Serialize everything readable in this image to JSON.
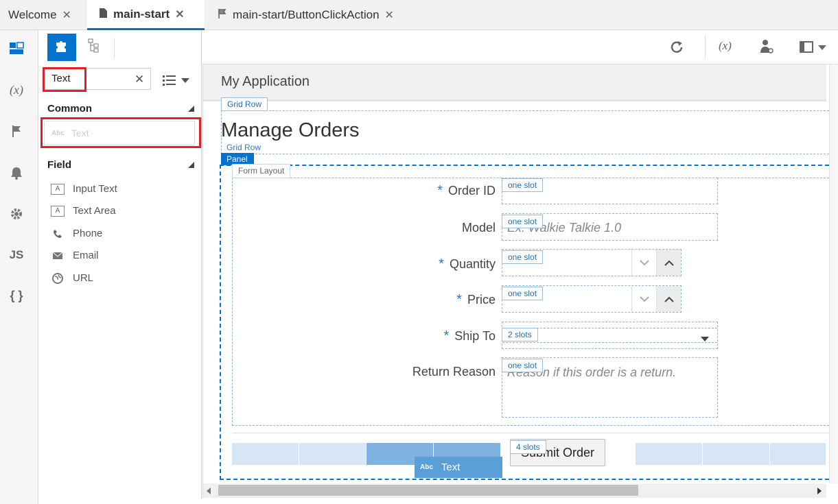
{
  "tabs": [
    {
      "label": "Welcome",
      "close": "✕"
    },
    {
      "label": "main-start",
      "close": "✕"
    },
    {
      "label": "main-start/ButtonClickAction",
      "close": "✕"
    }
  ],
  "rail": {
    "icons": [
      "page-designer-icon",
      "variables-icon",
      "flag-icon",
      "bell-icon",
      "gear-icon",
      "js-icon",
      "json-icon"
    ],
    "var_text": "(x)",
    "js_text": "JS",
    "json_text": "{ }"
  },
  "palette": {
    "search_value": "Text",
    "clear": "✕",
    "sections": {
      "common": {
        "title": "Common",
        "items": [
          "Text"
        ]
      },
      "field": {
        "title": "Field",
        "items": [
          "Input Text",
          "Text Area",
          "Phone",
          "Email",
          "URL"
        ]
      }
    }
  },
  "toolbar": {
    "icons": [
      "reload-icon",
      "variables-icon",
      "user-role-icon",
      "preview-device-icon"
    ],
    "var_text": "(x)"
  },
  "canvas": {
    "app_title": "My Application",
    "page_heading": "Manage Orders",
    "labels": {
      "grid_row": "Grid Row",
      "panel": "Panel",
      "form_layout": "Form Layout",
      "one_slot": "one slot",
      "two_slots": "2 slots",
      "four_slots": "4 slots"
    },
    "fields": [
      {
        "label": "Order ID",
        "required": true,
        "placeholder": ""
      },
      {
        "label": "Model",
        "required": false,
        "placeholder": "Ex: Walkie Talkie 1.0"
      },
      {
        "label": "Quantity",
        "required": true,
        "placeholder": ""
      },
      {
        "label": "Price",
        "required": true,
        "placeholder": ""
      },
      {
        "label": "Ship To",
        "required": true,
        "placeholder": ""
      },
      {
        "label": "Return Reason",
        "required": false,
        "placeholder": "Reason if this order is a return."
      }
    ],
    "required_mark": "*",
    "submit_label": "Submit Order",
    "drag_label": "Text",
    "abc": "Abc"
  },
  "colors": {
    "accent": "#0572ce",
    "highlight": "#e0202a",
    "drop_zone": "#d6e6f4",
    "drop_active": "#7fb2e1"
  }
}
